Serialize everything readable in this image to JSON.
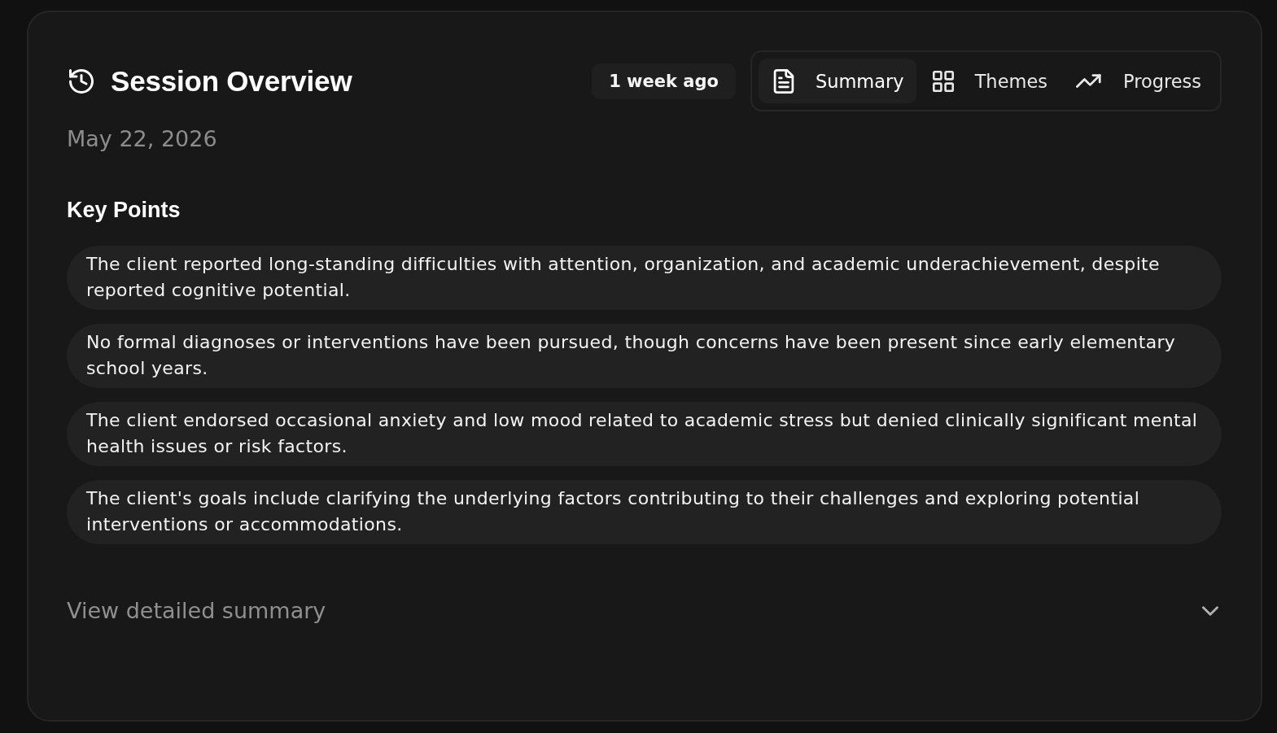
{
  "header": {
    "title": "Session Overview",
    "relative_time": "1 week ago",
    "date": "May 22, 2026"
  },
  "tabs": [
    {
      "label": "Summary",
      "kind": "document",
      "selected": true
    },
    {
      "label": "Themes",
      "kind": "grid",
      "selected": false
    },
    {
      "label": "Progress",
      "kind": "trend",
      "selected": false
    }
  ],
  "key_points": {
    "heading": "Key Points",
    "items": [
      "The client reported long-standing difficulties with attention, organization, and academic underachievement, despite reported cognitive potential.",
      "No formal diagnoses or interventions have been pursued, though concerns have been present since early elementary school years.",
      "The client endorsed occasional anxiety and low mood related to academic stress but denied clinically significant mental health issues or risk factors.",
      "The client's goals include clarifying the underlying factors contributing to their challenges and exploring potential interventions or accommodations."
    ]
  },
  "details": {
    "label": "View detailed summary",
    "expanded": false
  }
}
